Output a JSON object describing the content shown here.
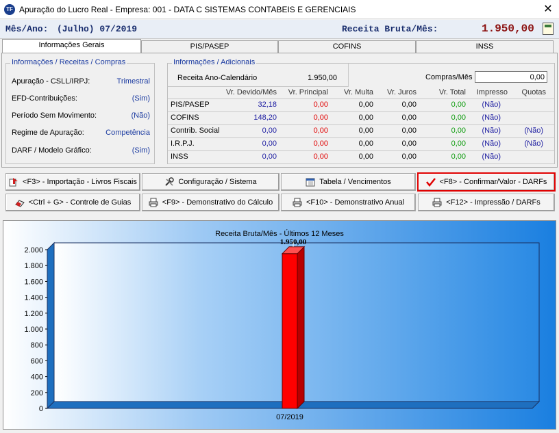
{
  "window": {
    "title": "Apuração do Lucro Real  -  Empresa: 001 - DATA C SISTEMAS CONTABEIS E GERENCIAIS",
    "icon_text": "TF",
    "close_glyph": "✕"
  },
  "header": {
    "period_label": "Mês/Ano:",
    "period_value": "(Julho) 07/2019",
    "revenue_label": "Receita Bruta/Mês:",
    "revenue_value": "1.950,00"
  },
  "tabs": [
    {
      "label": "Informações Gerais",
      "active": true
    },
    {
      "label": "PIS/PASEP",
      "active": false
    },
    {
      "label": "COFINS",
      "active": false
    },
    {
      "label": "INSS",
      "active": false
    }
  ],
  "info_group": {
    "title": "Informações / Receitas / Compras",
    "rows": [
      {
        "label": "Apuração - CSLL/IRPJ:",
        "value": "Trimestral"
      },
      {
        "label": "EFD-Contribuições:",
        "value": "(Sim)"
      },
      {
        "label": "Período Sem Movimento:",
        "value": "(Não)"
      },
      {
        "label": "Regime de Apuração:",
        "value": "Competência"
      },
      {
        "label": "DARF / Modelo Gráfico:",
        "value": "(Sim)"
      }
    ]
  },
  "additional_group": {
    "title": "Informações / Adicionais",
    "annual_revenue_label": "Receita Ano-Calendário",
    "annual_revenue_value": "1.950,00",
    "purchases_label": "Compras/Mês",
    "purchases_value": "0,00"
  },
  "tax_table": {
    "columns": [
      "Vr. Devido/Mês",
      "Vr. Principal",
      "Vr. Multa",
      "Vr. Juros",
      "Vr. Total",
      "Impresso",
      "Quotas"
    ],
    "rows": [
      {
        "name": "PIS/PASEP",
        "devido": "32,18",
        "principal": "0,00",
        "multa": "0,00",
        "juros": "0,00",
        "total": "0,00",
        "impresso": "(Não)",
        "quotas": ""
      },
      {
        "name": "COFINS",
        "devido": "148,20",
        "principal": "0,00",
        "multa": "0,00",
        "juros": "0,00",
        "total": "0,00",
        "impresso": "(Não)",
        "quotas": ""
      },
      {
        "name": "Contrib. Social",
        "devido": "0,00",
        "principal": "0,00",
        "multa": "0,00",
        "juros": "0,00",
        "total": "0,00",
        "impresso": "(Não)",
        "quotas": "(Não)"
      },
      {
        "name": "I.R.P.J.",
        "devido": "0,00",
        "principal": "0,00",
        "multa": "0,00",
        "juros": "0,00",
        "total": "0,00",
        "impresso": "(Não)",
        "quotas": "(Não)"
      },
      {
        "name": "INSS",
        "devido": "0,00",
        "principal": "0,00",
        "multa": "0,00",
        "juros": "0,00",
        "total": "0,00",
        "impresso": "(Não)",
        "quotas": ""
      }
    ]
  },
  "buttons": {
    "import": "<F3> - Importação - Livros Fiscais",
    "config": "Configuração / Sistema",
    "table": "Tabela / Vencimentos",
    "confirm": "<F8> - Confirmar/Valor - DARFs",
    "guides": "<Ctrl + G> - Controle de Guias",
    "calc_report": "<F9> - Demonstrativo do Cálculo",
    "annual_report": "<F10> - Demonstrativo Anual",
    "print_darfs": "<F12> - Impressão / DARFs"
  },
  "colors": {
    "accent_blue": "#1a3aa0",
    "value_red": "#e00000",
    "value_green": "#0a9a0a",
    "chart_bg": "#2d8be0",
    "bar_red": "#ff0000",
    "highlight_border": "#e00000"
  },
  "chart_data": {
    "type": "bar",
    "title": "Receita Bruta/Mês - Últimos 12 Meses",
    "categories": [
      "07/2019"
    ],
    "values": [
      1950
    ],
    "data_labels": [
      "1.950,00"
    ],
    "ylim": [
      0,
      2000
    ],
    "yticks": [
      "0",
      "200",
      "400",
      "600",
      "800",
      "1.000",
      "1.200",
      "1.400",
      "1.600",
      "1.800",
      "2.000"
    ],
    "ytick_values": [
      0,
      200,
      400,
      600,
      800,
      1000,
      1200,
      1400,
      1600,
      1800,
      2000
    ],
    "grid": false,
    "legend": "none"
  }
}
